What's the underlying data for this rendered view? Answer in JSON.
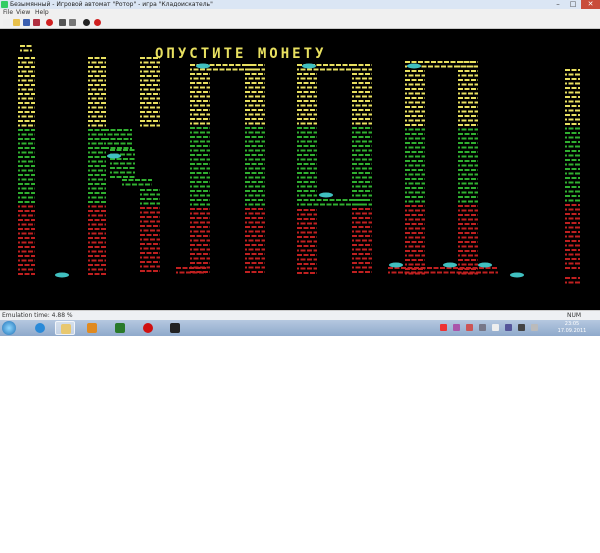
{
  "window": {
    "title": "Безымянный - Игровой автомат \"Ротор\" - игра \"Кладоискатель\"",
    "min_label": "–",
    "max_label": "□",
    "close_label": "✕"
  },
  "menu": [
    "File",
    "View",
    "Help"
  ],
  "toolbar": {
    "icons": [
      "new-icon",
      "open-icon",
      "save-icon",
      "settings-icon",
      "record-icon",
      "screenshot-icon",
      "config-icon",
      "play-icon",
      "stop-icon"
    ],
    "colors": [
      "#eee",
      "#e8c04a",
      "#3b5fb0",
      "#b03040",
      "#d02020",
      "#555",
      "#777",
      "#222",
      "#d02020"
    ]
  },
  "game": {
    "message": "ОПУСТИТЕ МОНЕТУ",
    "colors": {
      "yellow": "#e8e060",
      "green": "#30b030",
      "red": "#c02020",
      "cyan": "#40c0c0",
      "background": "#000000"
    }
  },
  "status": {
    "emulation": "Emulation time: 4.88 %",
    "mode": "NUM"
  },
  "taskbar": {
    "apps": [
      {
        "name": "internet-explorer-icon",
        "color": "#2a8ad8"
      },
      {
        "name": "file-explorer-icon",
        "color": "#e8c870"
      },
      {
        "name": "media-player-icon",
        "color": "#e08a20"
      },
      {
        "name": "emulator-app-icon",
        "color": "#2a7a2a"
      },
      {
        "name": "opera-icon",
        "color": "#d01010"
      },
      {
        "name": "game-window-icon",
        "color": "#222"
      }
    ],
    "tray": [
      "#e33",
      "#a5a",
      "#c55",
      "#778",
      "#eee",
      "#559",
      "#444",
      "#bbb"
    ],
    "clock_time": "23:05",
    "clock_date": "17.09.2011"
  }
}
